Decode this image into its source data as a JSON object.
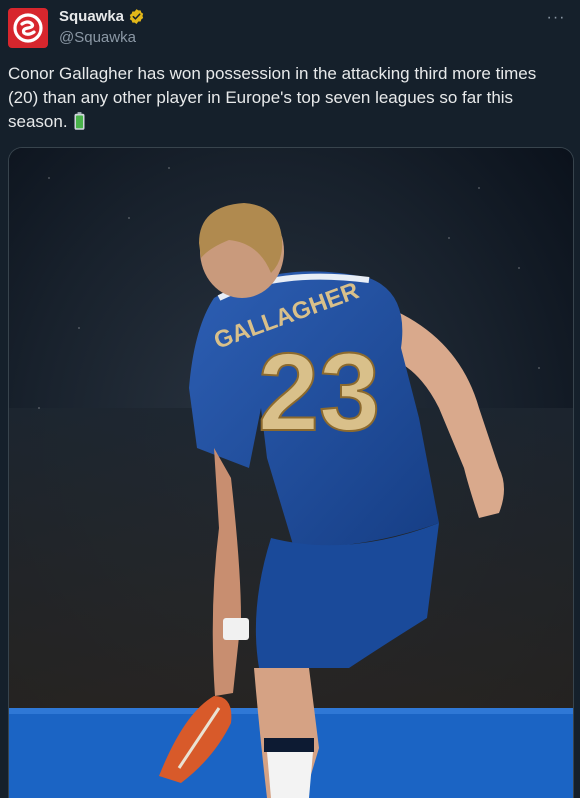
{
  "tweet": {
    "author_name": "Squawka",
    "author_handle": "@Squawka",
    "text": "Conor Gallagher has won possession in the attacking third more times (20) than any other player in Europe's top seven leagues so far this season.",
    "emoji": "battery-full",
    "more_label": "···"
  },
  "photo": {
    "jersey_name": "GALLAGHER",
    "jersey_number": "23"
  },
  "colors": {
    "background": "#15202b",
    "brand_red": "#d7262d",
    "verified_gold": "#e2b719",
    "kit_blue": "#1f4e9c",
    "kit_gold": "#d9c08a"
  }
}
